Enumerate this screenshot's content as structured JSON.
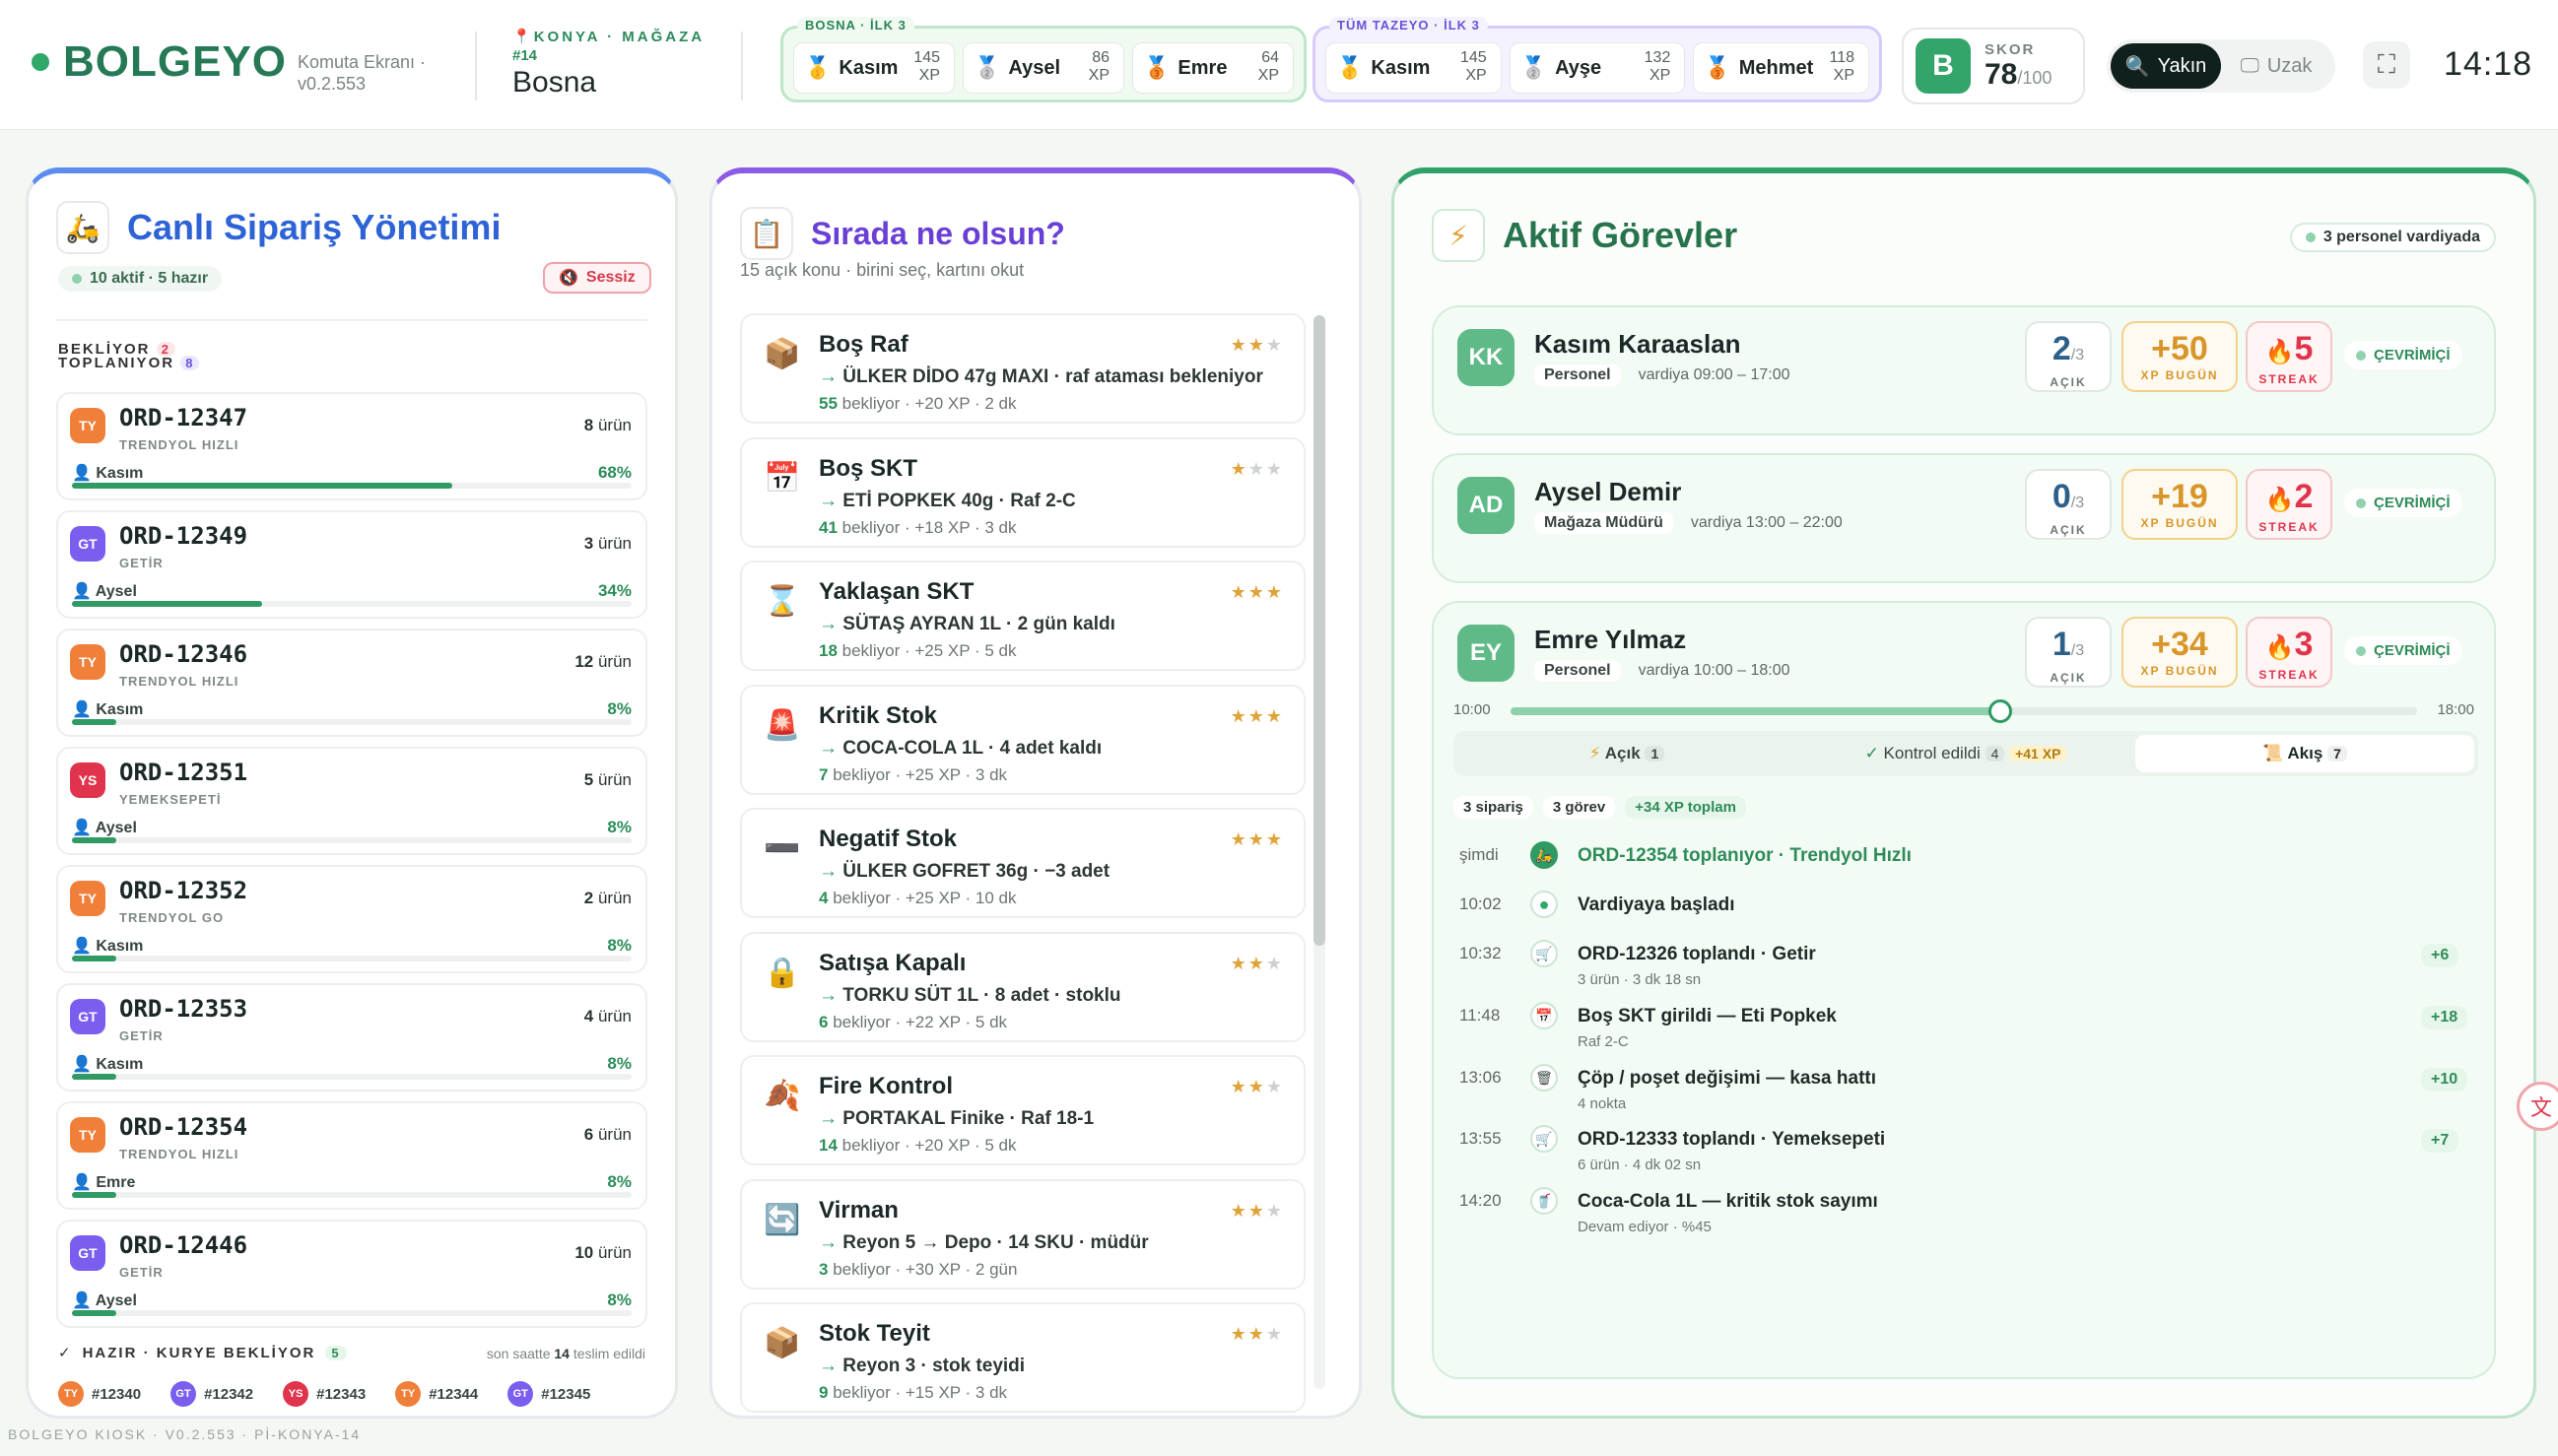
{
  "header": {
    "brand": "BOLGEYO",
    "screen": "Komuta Ekranı ·",
    "version": "v0.2.553",
    "location_tag": "KONYA · MAĞAZA",
    "store_no": "#14",
    "store_name": "Bosna",
    "bosna_title": "BOSNA · İLK 3",
    "bosna": [
      {
        "name": "Kasım",
        "xp": "145"
      },
      {
        "name": "Aysel",
        "xp": "86"
      },
      {
        "name": "Emre",
        "xp": "64"
      }
    ],
    "all_title": "TÜM TAZEYO · İLK 3",
    "all": [
      {
        "name": "Kasım",
        "xp": "145"
      },
      {
        "name": "Ayşe",
        "xp": "132"
      },
      {
        "name": "Mehmet",
        "xp": "118"
      }
    ],
    "xp_unit": "XP",
    "score_label": "SKOR",
    "score_letter": "B",
    "score": "78",
    "score_max": "/100",
    "seg_on": "Yakın",
    "seg_off": "Uzak",
    "time": "14:18"
  },
  "orders": {
    "title": "Canlı Sipariş Yönetimi",
    "summary": "10 aktif · 5 hazır",
    "mute": "Sessiz",
    "waiting_label": "BEKLİYOR",
    "waiting_count": "2",
    "picking_label": "TOPLANIYOR",
    "picking_count": "8",
    "items": [
      {
        "badge": "TY",
        "color": "#f07f3a",
        "id": "ORD-12347",
        "src": "TRENDYOL HIZLI",
        "count": "8",
        "unit": "ürün",
        "who": "Kasım",
        "pct": "68%",
        "progress": 68
      },
      {
        "badge": "GT",
        "color": "#7b5ef0",
        "id": "ORD-12349",
        "src": "GETİR",
        "count": "3",
        "unit": "ürün",
        "who": "Aysel",
        "pct": "34%",
        "progress": 34
      },
      {
        "badge": "TY",
        "color": "#f07f3a",
        "id": "ORD-12346",
        "src": "TRENDYOL HIZLI",
        "count": "12",
        "unit": "ürün",
        "who": "Kasım",
        "pct": "8%",
        "progress": 8
      },
      {
        "badge": "YS",
        "color": "#e0344d",
        "id": "ORD-12351",
        "src": "YEMEKSEPETİ",
        "count": "5",
        "unit": "ürün",
        "who": "Aysel",
        "pct": "8%",
        "progress": 8
      },
      {
        "badge": "TY",
        "color": "#f07f3a",
        "id": "ORD-12352",
        "src": "TRENDYOL GO",
        "count": "2",
        "unit": "ürün",
        "who": "Kasım",
        "pct": "8%",
        "progress": 8
      },
      {
        "badge": "GT",
        "color": "#7b5ef0",
        "id": "ORD-12353",
        "src": "GETİR",
        "count": "4",
        "unit": "ürün",
        "who": "Kasım",
        "pct": "8%",
        "progress": 8
      },
      {
        "badge": "TY",
        "color": "#f07f3a",
        "id": "ORD-12354",
        "src": "TRENDYOL HIZLI",
        "count": "6",
        "unit": "ürün",
        "who": "Emre",
        "pct": "8%",
        "progress": 8
      },
      {
        "badge": "GT",
        "color": "#7b5ef0",
        "id": "ORD-12446",
        "src": "GETİR",
        "count": "10",
        "unit": "ürün",
        "who": "Aysel",
        "pct": "8%",
        "progress": 8
      }
    ],
    "ready_label": "HAZIR · KURYE BEKLİYOR",
    "ready_count": "5",
    "ready_note_pre": "son saatte",
    "ready_note_num": "14",
    "ready_note_post": "teslim edildi",
    "ready_ids": [
      {
        "b": "TY",
        "c": "#f07f3a",
        "id": "#12340"
      },
      {
        "b": "GT",
        "c": "#7b5ef0",
        "id": "#12342"
      },
      {
        "b": "YS",
        "c": "#e0344d",
        "id": "#12343"
      },
      {
        "b": "TY",
        "c": "#f07f3a",
        "id": "#12344"
      },
      {
        "b": "GT",
        "c": "#7b5ef0",
        "id": "#12345"
      }
    ]
  },
  "queue": {
    "title": "Sırada ne olsun?",
    "subtitle": "15 açık konu · birini seç, kartını okut",
    "items": [
      {
        "icon": "📦",
        "title": "Boş Raf",
        "stars": 2,
        "detail": "ÜLKER DİDO 47g MAXI · raf ataması bekleniyor",
        "count": "55",
        "meta": " bekliyor · +20 XP · 2 dk"
      },
      {
        "icon": "📅",
        "title": "Boş SKT",
        "stars": 1,
        "detail": "ETİ POPKEK 40g · Raf 2-C",
        "count": "41",
        "meta": " bekliyor · +18 XP · 3 dk"
      },
      {
        "icon": "⌛",
        "title": "Yaklaşan SKT",
        "stars": 3,
        "detail": "SÜTAŞ AYRAN 1L · 2 gün kaldı",
        "count": "18",
        "meta": " bekliyor · +25 XP · 5 dk"
      },
      {
        "icon": "🚨",
        "title": "Kritik Stok",
        "stars": 3,
        "detail": "COCA-COLA 1L · 4 adet kaldı",
        "count": "7",
        "meta": " bekliyor · +25 XP · 3 dk"
      },
      {
        "icon": "➖",
        "title": "Negatif Stok",
        "stars": 3,
        "detail": "ÜLKER GOFRET 36g · −3 adet",
        "count": "4",
        "meta": " bekliyor · +25 XP · 10 dk"
      },
      {
        "icon": "🔒",
        "title": "Satışa Kapalı",
        "stars": 2,
        "detail": "TORKU SÜT 1L · 8 adet · stoklu",
        "count": "6",
        "meta": " bekliyor · +22 XP · 5 dk"
      },
      {
        "icon": "🍂",
        "title": "Fire Kontrol",
        "stars": 2,
        "detail": "PORTAKAL Finike · Raf 18-1",
        "count": "14",
        "meta": " bekliyor · +20 XP · 5 dk"
      },
      {
        "icon": "🔄",
        "title": "Virman",
        "stars": 2,
        "detail": "Reyon 5 → Depo · 14 SKU · müdür",
        "count": "3",
        "meta": " bekliyor · +30 XP · 2 gün"
      },
      {
        "icon": "📦",
        "title": "Stok Teyit",
        "stars": 2,
        "detail": "Reyon 3 · stok teyidi",
        "count": "9",
        "meta": " bekliyor · +15 XP · 3 dk"
      }
    ]
  },
  "tasks": {
    "title": "Aktif Görevler",
    "shift": "3 personel vardiyada",
    "people": [
      {
        "initials": "KK",
        "name": "Kasım Karaaslan",
        "role": "Personel",
        "shift": "vardiya 09:00 – 17:00",
        "open": "2",
        "open_max": "/3",
        "xp": "+50",
        "streak": "5"
      },
      {
        "initials": "AD",
        "name": "Aysel Demir",
        "role": "Mağaza Müdürü",
        "shift": "vardiya 13:00 – 22:00",
        "open": "0",
        "open_max": "/3",
        "xp": "+19",
        "streak": "2"
      },
      {
        "initials": "EY",
        "name": "Emre Yılmaz",
        "role": "Personel",
        "shift": "vardiya 10:00 – 18:00",
        "open": "1",
        "open_max": "/3",
        "xp": "+34",
        "streak": "3"
      }
    ],
    "labels": {
      "open": "AÇIK",
      "xp": "XP BUGÜN",
      "streak": "STREAK",
      "online": "ÇEVRİMİÇİ"
    },
    "shift_start": "10:00",
    "shift_end": "18:00",
    "shift_progress": 0.54,
    "tabs": {
      "open": "Açık",
      "open_count": "1",
      "checked": "Kontrol edildi",
      "checked_count": "4",
      "checked_xp": "+41 XP",
      "flow": "Akış",
      "flow_count": "7"
    },
    "chips": [
      "3 sipariş",
      "3 görev",
      "+34 XP toplam"
    ],
    "timeline": [
      {
        "time": "şimdi",
        "icon": "🛵",
        "text": "ORD-12354 toplanıyor · Trendyol Hızlı",
        "sub": "",
        "xp": "",
        "active": true
      },
      {
        "time": "10:02",
        "icon": "●",
        "text": "Vardiyaya başladı",
        "sub": "",
        "xp": ""
      },
      {
        "time": "10:32",
        "icon": "🛒",
        "text": "ORD-12326 toplandı · Getir",
        "sub": "3 ürün · 3 dk 18 sn",
        "xp": "+6"
      },
      {
        "time": "11:48",
        "icon": "📅",
        "text": "Boş SKT girildi — Eti Popkek",
        "sub": "Raf 2-C",
        "xp": "+18"
      },
      {
        "time": "13:06",
        "icon": "🗑",
        "text": "Çöp / poşet değişimi — kasa hattı",
        "sub": "4 nokta",
        "xp": "+10"
      },
      {
        "time": "13:55",
        "icon": "🛒",
        "text": "ORD-12333 toplandı · Yemeksepeti",
        "sub": "6 ürün · 4 dk 02 sn",
        "xp": "+7"
      },
      {
        "time": "14:20",
        "icon": "🥤",
        "text": "Coca-Cola 1L — kritik stok sayımı",
        "sub": "Devam ediyor · %45",
        "xp": ""
      }
    ]
  },
  "footer": "BOLGEYO KIOSK · V0.2.553 · Pİ-KONYA-14"
}
